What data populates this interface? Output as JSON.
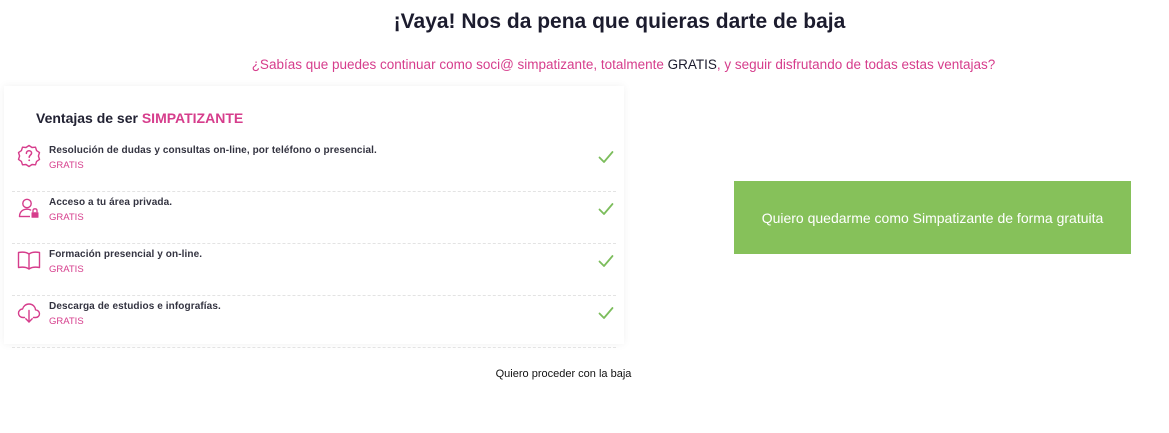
{
  "header": {
    "title": "¡Vaya! Nos da pena que quieras darte de baja",
    "subtitle_before": "¿Sabías que puedes continuar como soci@ simpatizante, totalmente ",
    "subtitle_strong": "GRATIS",
    "subtitle_after": ", y seguir disfrutando de todas estas ventajas?"
  },
  "benefits_card": {
    "heading_prefix": "Ventajas de ser ",
    "heading_accent": "SIMPATIZANTE",
    "items": [
      {
        "title": "Resolución de dudas y consultas on-line, por teléfono o presencial.",
        "subtitle": "GRATIS",
        "icon": "question-badge-icon"
      },
      {
        "title": "Acceso a tu área privada.",
        "subtitle": "GRATIS",
        "icon": "user-lock-icon"
      },
      {
        "title": "Formación presencial y on-line.",
        "subtitle": "GRATIS",
        "icon": "open-book-icon"
      },
      {
        "title": "Descarga de estudios e infografías.",
        "subtitle": "GRATIS",
        "icon": "cloud-download-icon"
      }
    ]
  },
  "actions": {
    "stay_label": "Quiero quedarme como Simpatizante de forma gratuita",
    "leave_label": "Quiero proceder con la baja"
  },
  "colors": {
    "accent": "#d63d8c",
    "button_green": "#86c15a",
    "check_green": "#7cbd5c",
    "title": "#1c1c2e"
  }
}
